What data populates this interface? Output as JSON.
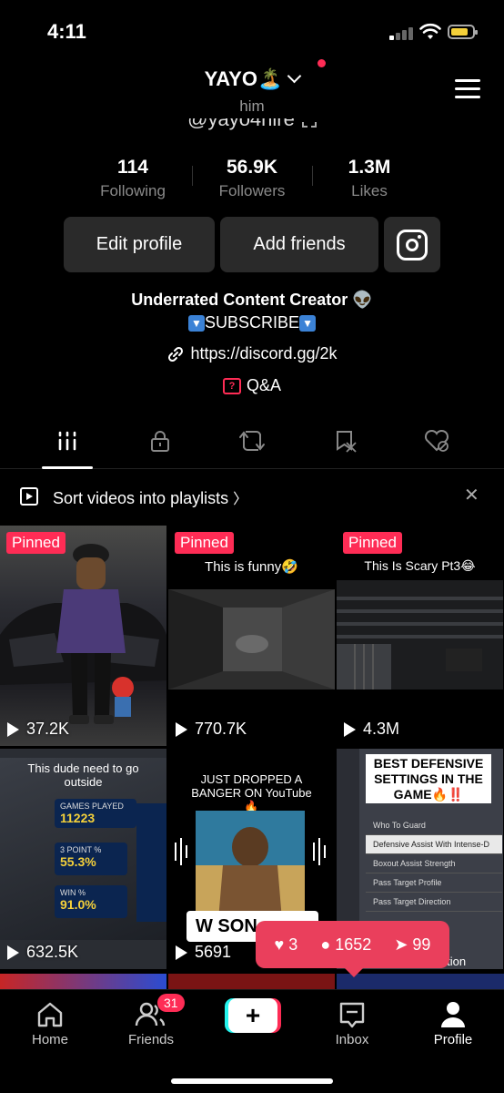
{
  "status_bar": {
    "time": "4:11"
  },
  "header": {
    "display_name": "YAYO",
    "name_emoji": "🏝️",
    "pronoun": "him",
    "handle": "@yayo4hire"
  },
  "stats": [
    {
      "value": "114",
      "label": "Following"
    },
    {
      "value": "56.9K",
      "label": "Followers"
    },
    {
      "value": "1.3M",
      "label": "Likes"
    }
  ],
  "buttons": {
    "edit_profile": "Edit profile",
    "add_friends": "Add friends"
  },
  "bio": {
    "line1": "Underrated Content Creator",
    "line1_emoji": "👽",
    "subscribe": "SUBSCRIBE",
    "link": "https://discord.gg/2k",
    "qa": "Q&A"
  },
  "playlist_bar": {
    "text": "Sort videos into playlists"
  },
  "videos": [
    {
      "pinned": "Pinned",
      "views": "37.2K",
      "caption": ""
    },
    {
      "pinned": "Pinned",
      "views": "770.7K",
      "caption": "This is funny🤣"
    },
    {
      "pinned": "Pinned",
      "views": "4.3M",
      "caption": "This Is Scary Pt3😂"
    },
    {
      "views": "632.5K",
      "caption": "This dude need to go outside",
      "stats": {
        "games_played_label": "GAMES PLAYED",
        "games_played": "11223",
        "three_pt_label": "3 POINT %",
        "three_pt": "55.3%",
        "win_label": "WIN %",
        "win": "91.0%"
      }
    },
    {
      "views": "5691",
      "caption": "JUST DROPPED A BANGER ON YouTube 🔥",
      "overlay": "W SON"
    },
    {
      "views": "",
      "caption": "BEST DEFENSIVE SETTINGS IN THE GAME🔥‼️",
      "menu": [
        "Who To Guard",
        "Defensive Assist With Intense-D",
        "Boxout Assist Strength",
        "Pass Target Profile",
        "Pass Target Direction"
      ],
      "footer": "Black Mamba Edition"
    }
  ],
  "activity_badge": {
    "likes": "3",
    "followers": "1652",
    "shares": "99"
  },
  "nav": {
    "home": "Home",
    "friends": "Friends",
    "friends_badge": "31",
    "create": "+",
    "inbox": "Inbox",
    "profile": "Profile"
  },
  "colors": {
    "accent": "#fe2c55",
    "background": "#000000",
    "button_bg": "#2a2a2a"
  }
}
